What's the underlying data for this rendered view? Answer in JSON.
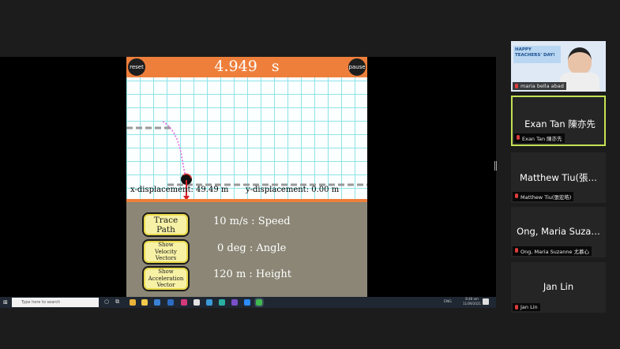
{
  "simulation": {
    "reset_label": "reset",
    "pause_label": "pause",
    "time": "4.949",
    "time_unit": "s",
    "x_displacement": "x-displacement: 49.49 m",
    "y_displacement": "y-displacement: 0.00 m",
    "buttons": {
      "trace_path": [
        "Trace",
        "Path"
      ],
      "show_velocity": [
        "Show",
        "Velocity",
        "Vectors"
      ],
      "show_acceleration": [
        "Show",
        "Acceleration",
        "Vector"
      ]
    },
    "values": {
      "speed": "10 m/s  : Speed",
      "angle": "0 deg  : Angle",
      "height": "120 m  : Height"
    },
    "colors": {
      "header": "#ee7f3b",
      "grid_line": "#8fe3e8",
      "trajectory": "#e85ee0",
      "panel": "#8b8676",
      "button_fill": "#f7f1a6"
    }
  },
  "taskbar": {
    "search_placeholder": "Type here to search",
    "tray_lang": "ENG",
    "tray_time": "8:48 am",
    "tray_date": "11/09/2021"
  },
  "participants": [
    {
      "name": "",
      "tag": "maria bella abad",
      "video": true,
      "banner": "HAPPY TEACHERS' DAY!"
    },
    {
      "name": "Exan Tan 陳亦先",
      "tag": "Exan Tan 陳亦先",
      "active": true
    },
    {
      "name": "Matthew Tiu(張…",
      "tag": "Matthew Tiu(張宏皓)"
    },
    {
      "name": "Ong, Maria Suza…",
      "tag": "Ong, Maria Suzanne 尤慕心"
    },
    {
      "name": "Jan Lin",
      "tag": "Jan Lin"
    }
  ]
}
